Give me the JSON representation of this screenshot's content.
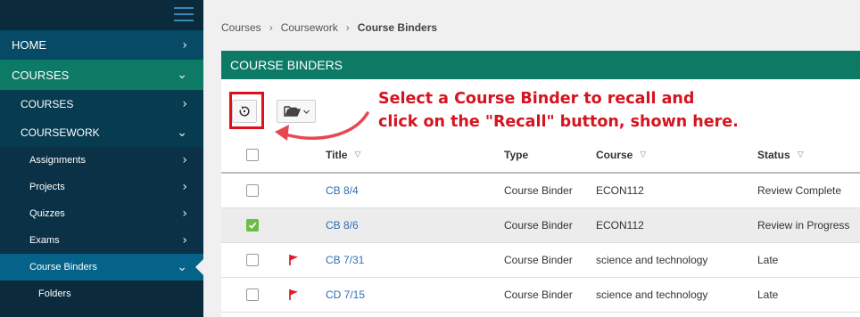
{
  "sidebar": {
    "items": [
      {
        "label": "HOME",
        "chevron": "›"
      },
      {
        "label": "COURSES",
        "chevron": "⌄"
      },
      {
        "label": "COURSES",
        "chevron": "›"
      },
      {
        "label": "COURSEWORK",
        "chevron": "⌄"
      },
      {
        "label": "Assignments",
        "chevron": "›"
      },
      {
        "label": "Projects",
        "chevron": "›"
      },
      {
        "label": "Quizzes",
        "chevron": "›"
      },
      {
        "label": "Exams",
        "chevron": "›"
      },
      {
        "label": "Course Binders",
        "chevron": "⌄"
      },
      {
        "label": "Folders"
      }
    ]
  },
  "breadcrumb": {
    "items": [
      "Courses",
      "Coursework"
    ],
    "current": "Course Binders",
    "separator": "›"
  },
  "panel": {
    "title": "COURSE BINDERS"
  },
  "annotation": {
    "line1": "Select a Course Binder to recall and",
    "line2": "click on the \"Recall\" button, shown here."
  },
  "toolbar": {
    "recall_icon": "recall-icon",
    "folder_icon": "folder-open-icon"
  },
  "table": {
    "headers": {
      "title": "Title",
      "type": "Type",
      "course": "Course",
      "status": "Status"
    },
    "sort_glyph": "▽",
    "rows": [
      {
        "title": "CB 8/4",
        "type": "Course Binder",
        "course": "ECON112",
        "status": "Review Complete",
        "flag": false,
        "checked": false
      },
      {
        "title": "CB 8/6",
        "type": "Course Binder",
        "course": "ECON112",
        "status": "Review in Progress",
        "flag": false,
        "checked": true
      },
      {
        "title": "CB 7/31",
        "type": "Course Binder",
        "course": "science and technology",
        "status": "Late",
        "flag": true,
        "checked": false
      },
      {
        "title": "CD 7/15",
        "type": "Course Binder",
        "course": "science and technology",
        "status": "Late",
        "flag": true,
        "checked": false
      }
    ]
  },
  "colors": {
    "sidebar_bg": "#0b2b3c",
    "accent_green": "#0d7a66",
    "active_blue": "#05638a",
    "annotation_red": "#d5141f",
    "link_blue": "#2d6fb7",
    "check_green": "#6cbd45"
  }
}
